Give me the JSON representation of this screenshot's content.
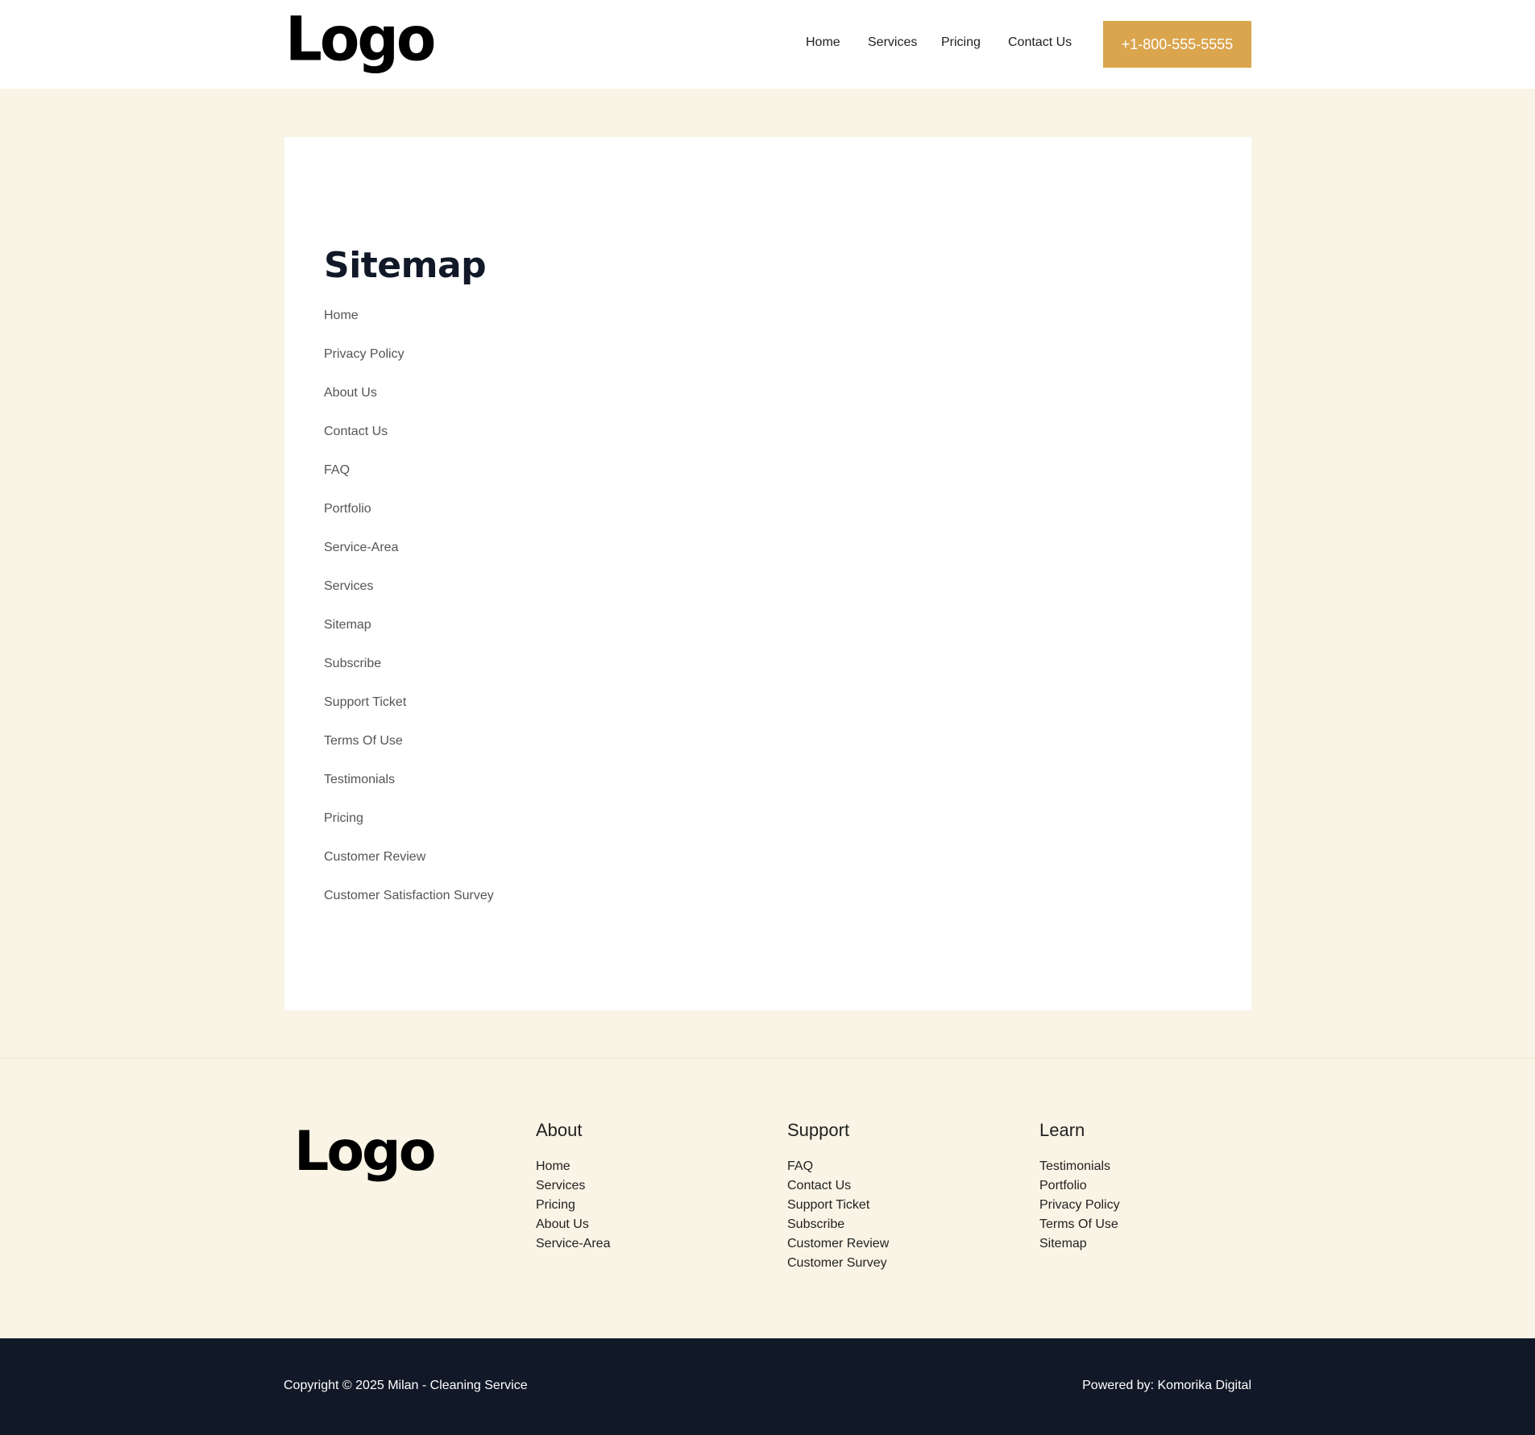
{
  "header": {
    "logo": "Logo",
    "nav": [
      "Home",
      "Services",
      "Pricing",
      "Contact Us"
    ],
    "phone": "+1-800-555-5555"
  },
  "main": {
    "title": "Sitemap",
    "links": [
      "Home",
      "Privacy Policy",
      "About Us",
      "Contact Us",
      "FAQ",
      "Portfolio",
      "Service-Area",
      "Services",
      "Sitemap",
      "Subscribe",
      "Support Ticket",
      "Terms Of Use",
      "Testimonials",
      "Pricing",
      "Customer Review",
      "Customer Satisfaction Survey"
    ]
  },
  "footer": {
    "logo": "Logo",
    "columns": [
      {
        "title": "About",
        "items": [
          "Home",
          "Services",
          "Pricing",
          "About Us",
          "Service-Area"
        ]
      },
      {
        "title": "Support",
        "items": [
          "FAQ",
          "Contact Us",
          "Support Ticket",
          "Subscribe",
          "Customer Review",
          "Customer Survey"
        ]
      },
      {
        "title": "Learn",
        "items": [
          "Testimonials",
          "Portfolio",
          "Privacy Policy",
          "Terms Of Use",
          "Sitemap"
        ]
      }
    ]
  },
  "bottom": {
    "copyright": "Copyright © 2025 Milan - Cleaning Service",
    "powered": "Powered by: Komorika Digital"
  },
  "colors": {
    "accent": "#daa54d",
    "page_background": "#f9f4e5",
    "dark": "#111827"
  }
}
